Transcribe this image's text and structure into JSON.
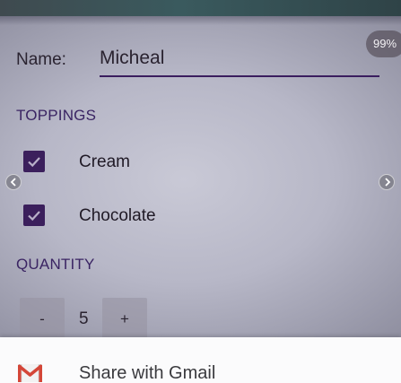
{
  "status": {
    "zoom_badge": "99%"
  },
  "form": {
    "name_label": "Name:",
    "name_value": "Micheal",
    "toppings_heading": "TOPPINGS",
    "toppings": [
      {
        "label": "Cream",
        "checked": true
      },
      {
        "label": "Chocolate",
        "checked": true
      }
    ],
    "quantity_heading": "QUANTITY",
    "quantity": {
      "minus_label": "-",
      "value": "5",
      "plus_label": "+"
    }
  },
  "share_sheet": {
    "option_label": "Share with Gmail",
    "icon": "gmail-icon"
  },
  "colors": {
    "accent": "#3a2463",
    "checkbox": "#3b1f5c",
    "share_background": "#fbfbfc"
  },
  "icons": {
    "previous": "chevron-left-icon",
    "next": "chevron-right-icon",
    "checkbox_mark": "check-icon"
  }
}
